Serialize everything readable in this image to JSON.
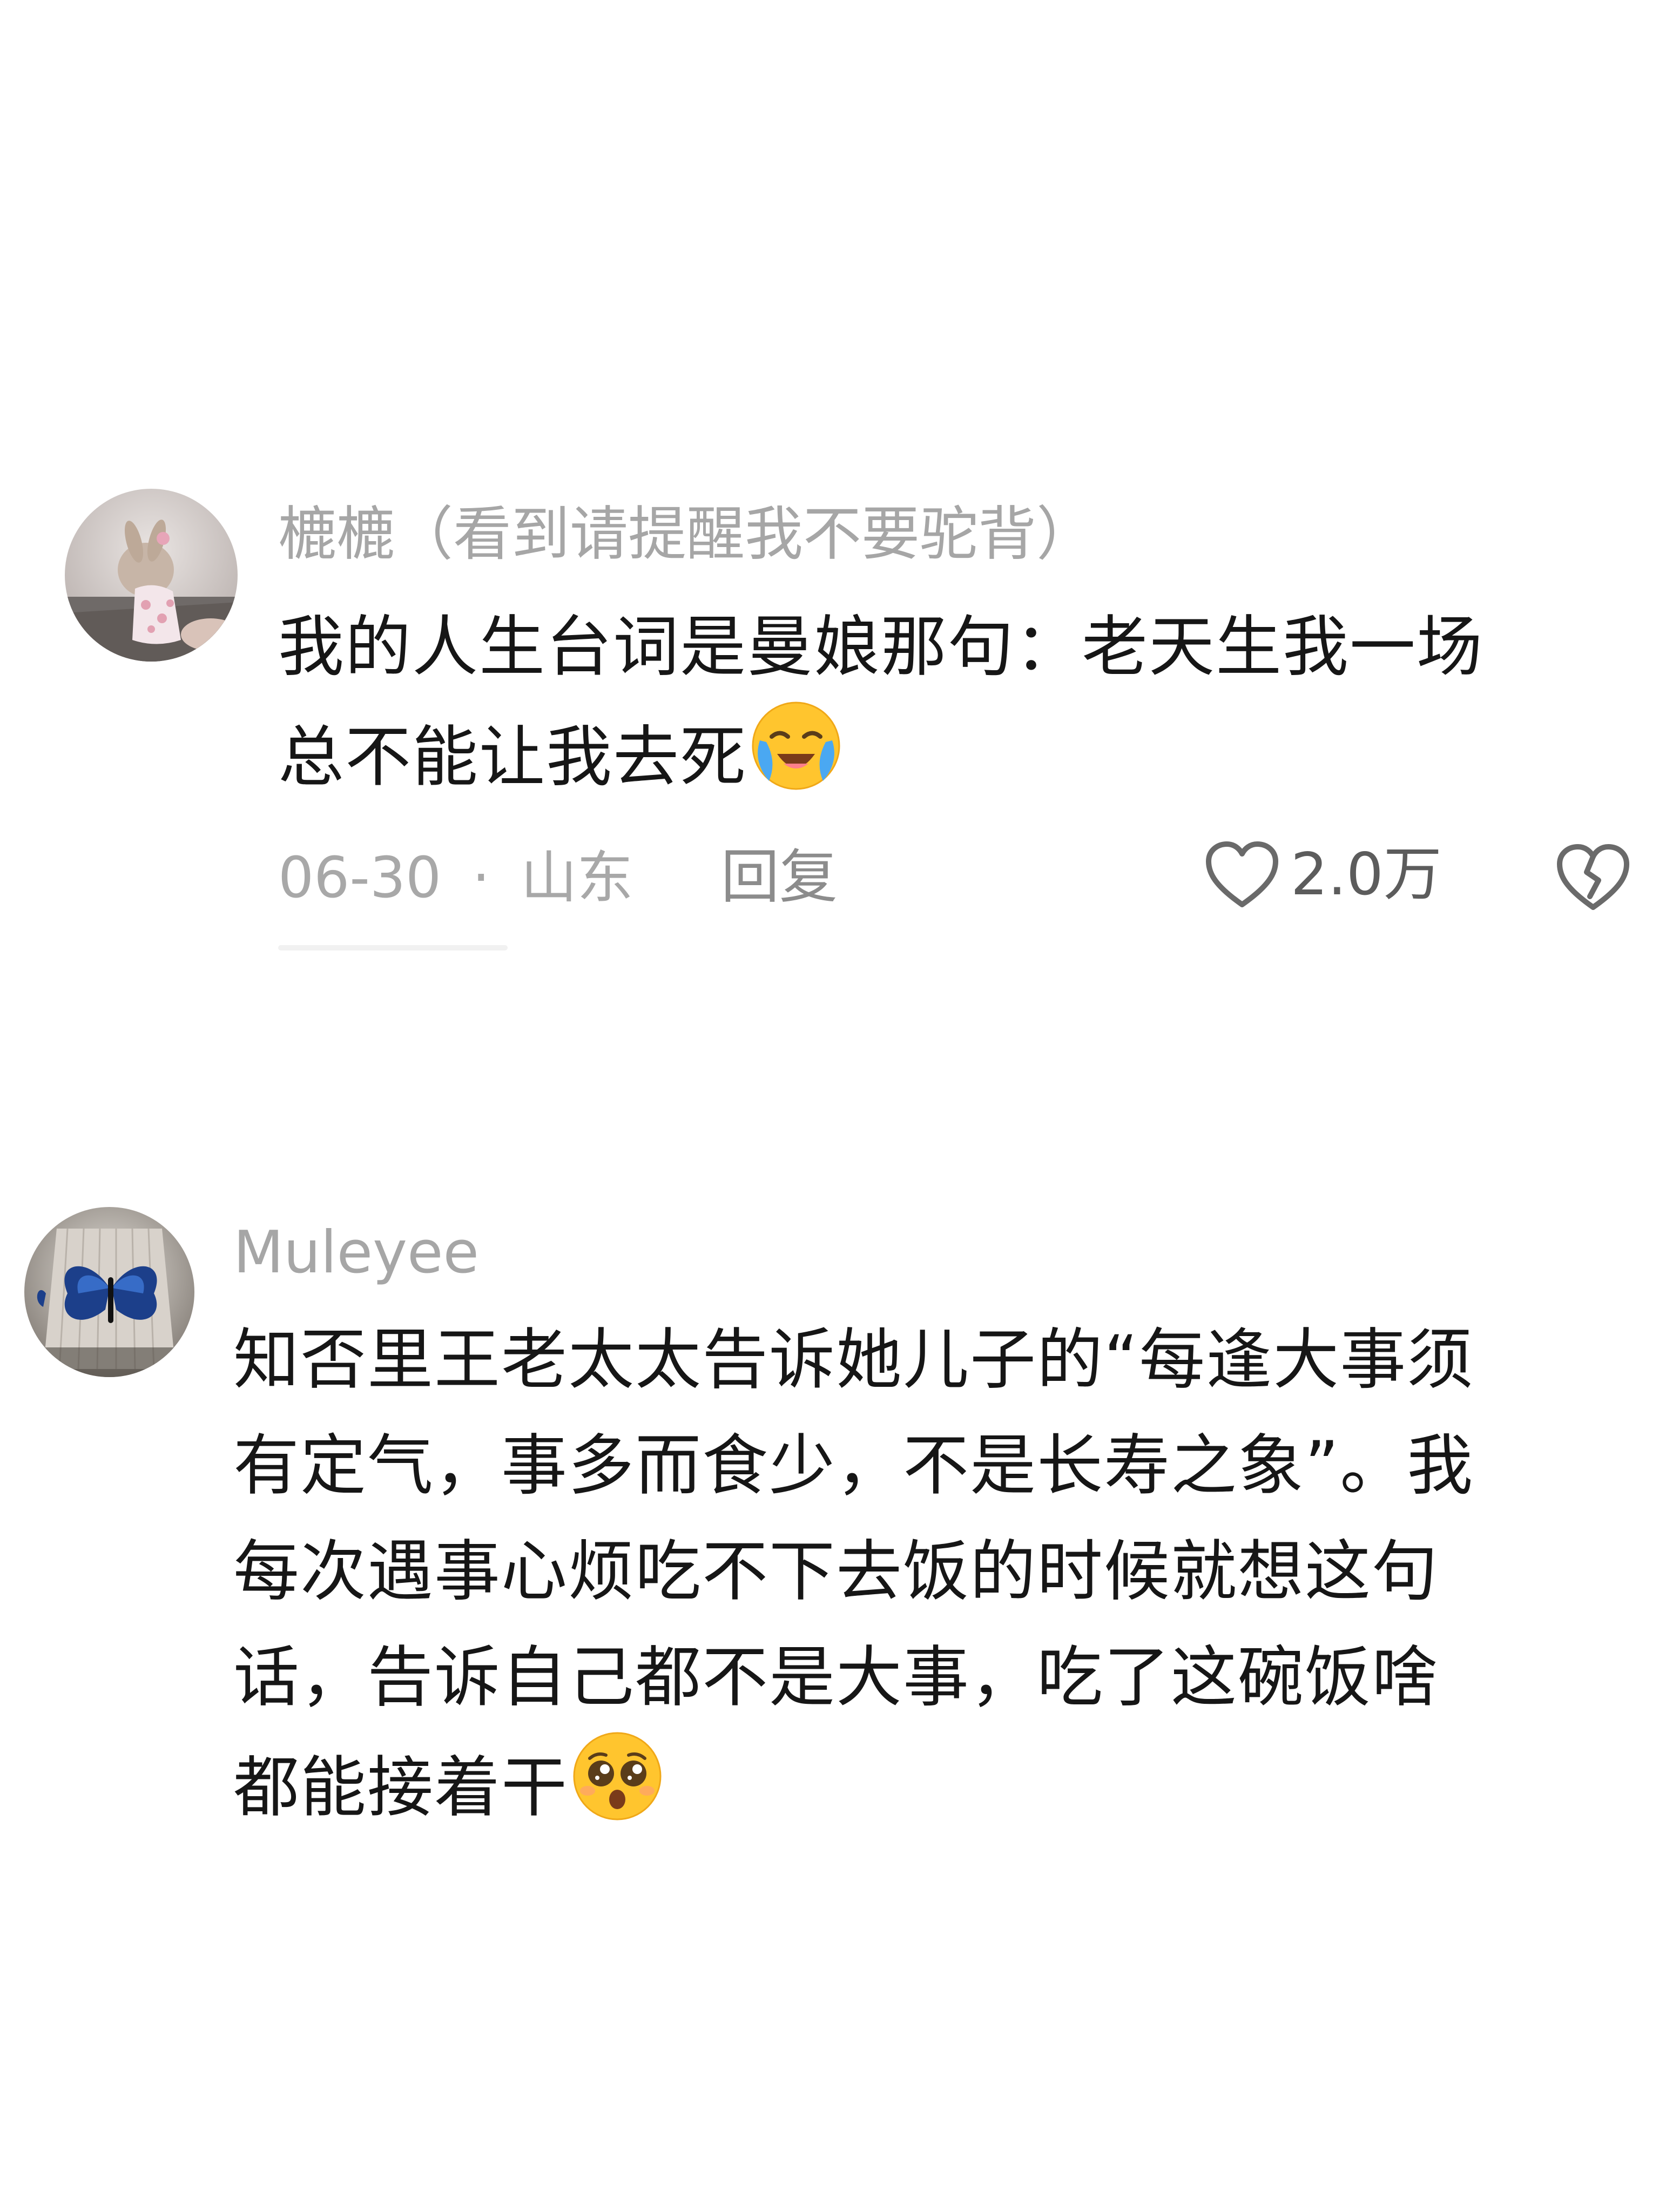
{
  "comments": [
    {
      "username": "樚樚（看到请提醒我不要驼背）",
      "lines": [
        "我的人生台词是曼娘那句：老天生我一场",
        "总不能让我去死"
      ],
      "emoji": "loudly-crying-face",
      "date": "06-30",
      "separator": "·",
      "location": "山东",
      "reply_label": "回复",
      "likes": "2.0万"
    },
    {
      "username": "Muleyee",
      "lines": [
        "知否里王老太太告诉她儿子的“每逢大事须",
        "有定气，事多而食少，不是长寿之象”。我",
        "每次遇事心烦吃不下去饭的时候就想这句",
        "话，告诉自己都不是大事，吃了这碗饭啥",
        "都能接着干"
      ],
      "emoji": "pleading-face"
    }
  ],
  "colors": {
    "username": "#a6a6a6",
    "content": "#161616",
    "meta": "#a8a8a8",
    "emoji_yellow": "#ffc52e"
  }
}
